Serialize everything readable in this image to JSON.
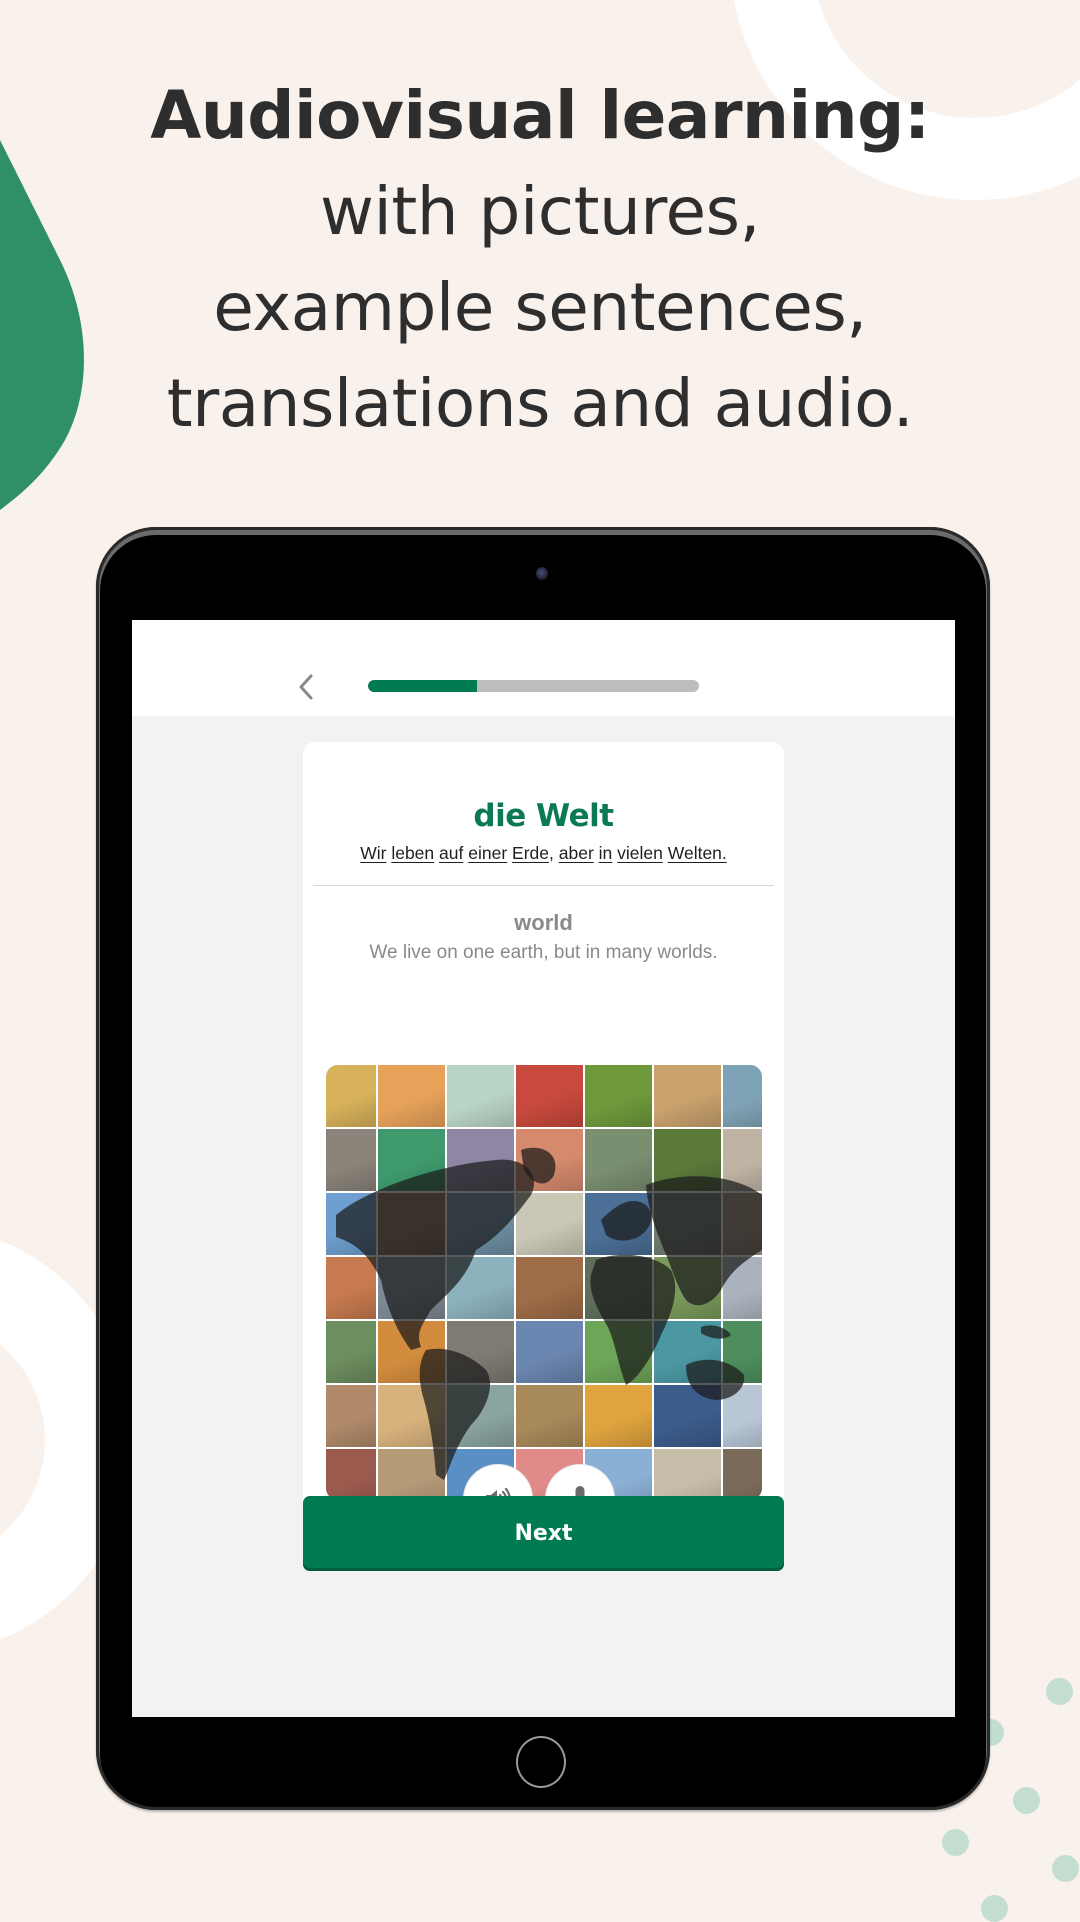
{
  "headline": {
    "bold_line": "Audiovisual learning:",
    "lines": [
      "with pictures,",
      "example sentences,",
      "translations and audio."
    ]
  },
  "app": {
    "progress_fraction": 0.33,
    "accent_color": "#007a4f",
    "card": {
      "word_de": "die Welt",
      "sentence_de_words": [
        "Wir",
        "leben",
        "auf",
        "einer",
        "Erde",
        ",",
        "aber",
        "in",
        "vielen",
        "Welten."
      ],
      "word_en": "world",
      "sentence_en": "We live on one earth, but in many worlds.",
      "image_description": "collage of travel photos with world map overlay",
      "audio_icon": "speaker-icon",
      "mic_icon": "microphone-icon"
    },
    "next_label": "Next"
  },
  "colors": {
    "background": "#f9f2ec",
    "blob": "#2f9068",
    "dots": "#c3ddd1",
    "headline": "#2e2e2e"
  },
  "tiles": [
    [
      "#d7b25a",
      "#e7a25a",
      "#b9d5c6",
      "#c8493d",
      "#6f9a3c",
      "#c9a26d",
      "#7fa3b6"
    ],
    [
      "#8a847a",
      "#3e9a6d",
      "#8e86a3",
      "#d58a6e",
      "#7a8e70",
      "#5b7a3a",
      "#bfb3a4"
    ],
    [
      "#6f9fd0",
      "#8b6d55",
      "#6d8fa4",
      "#c9c7b5",
      "#4b6f96",
      "#6e7a6e",
      "#a4907e"
    ],
    [
      "#c77a4f",
      "#7d8a96",
      "#8cb2bd",
      "#9e6c47",
      "#5f6e5b",
      "#7a9a5b",
      "#aab3bd"
    ],
    [
      "#6d8e5f",
      "#d28c3e",
      "#7f7a72",
      "#6b86b0",
      "#6da657",
      "#4b98a3",
      "#4d8e5c"
    ],
    [
      "#b08a6a",
      "#d8b27d",
      "#8aa5a0",
      "#a8895a",
      "#e0a43e",
      "#3c5c8c",
      "#b8c6d6"
    ],
    [
      "#9b5a4e",
      "#b59a78",
      "#5a8fc3",
      "#e08a8a",
      "#8bb0d6",
      "#c6bda9",
      "#7a6a5a"
    ]
  ]
}
